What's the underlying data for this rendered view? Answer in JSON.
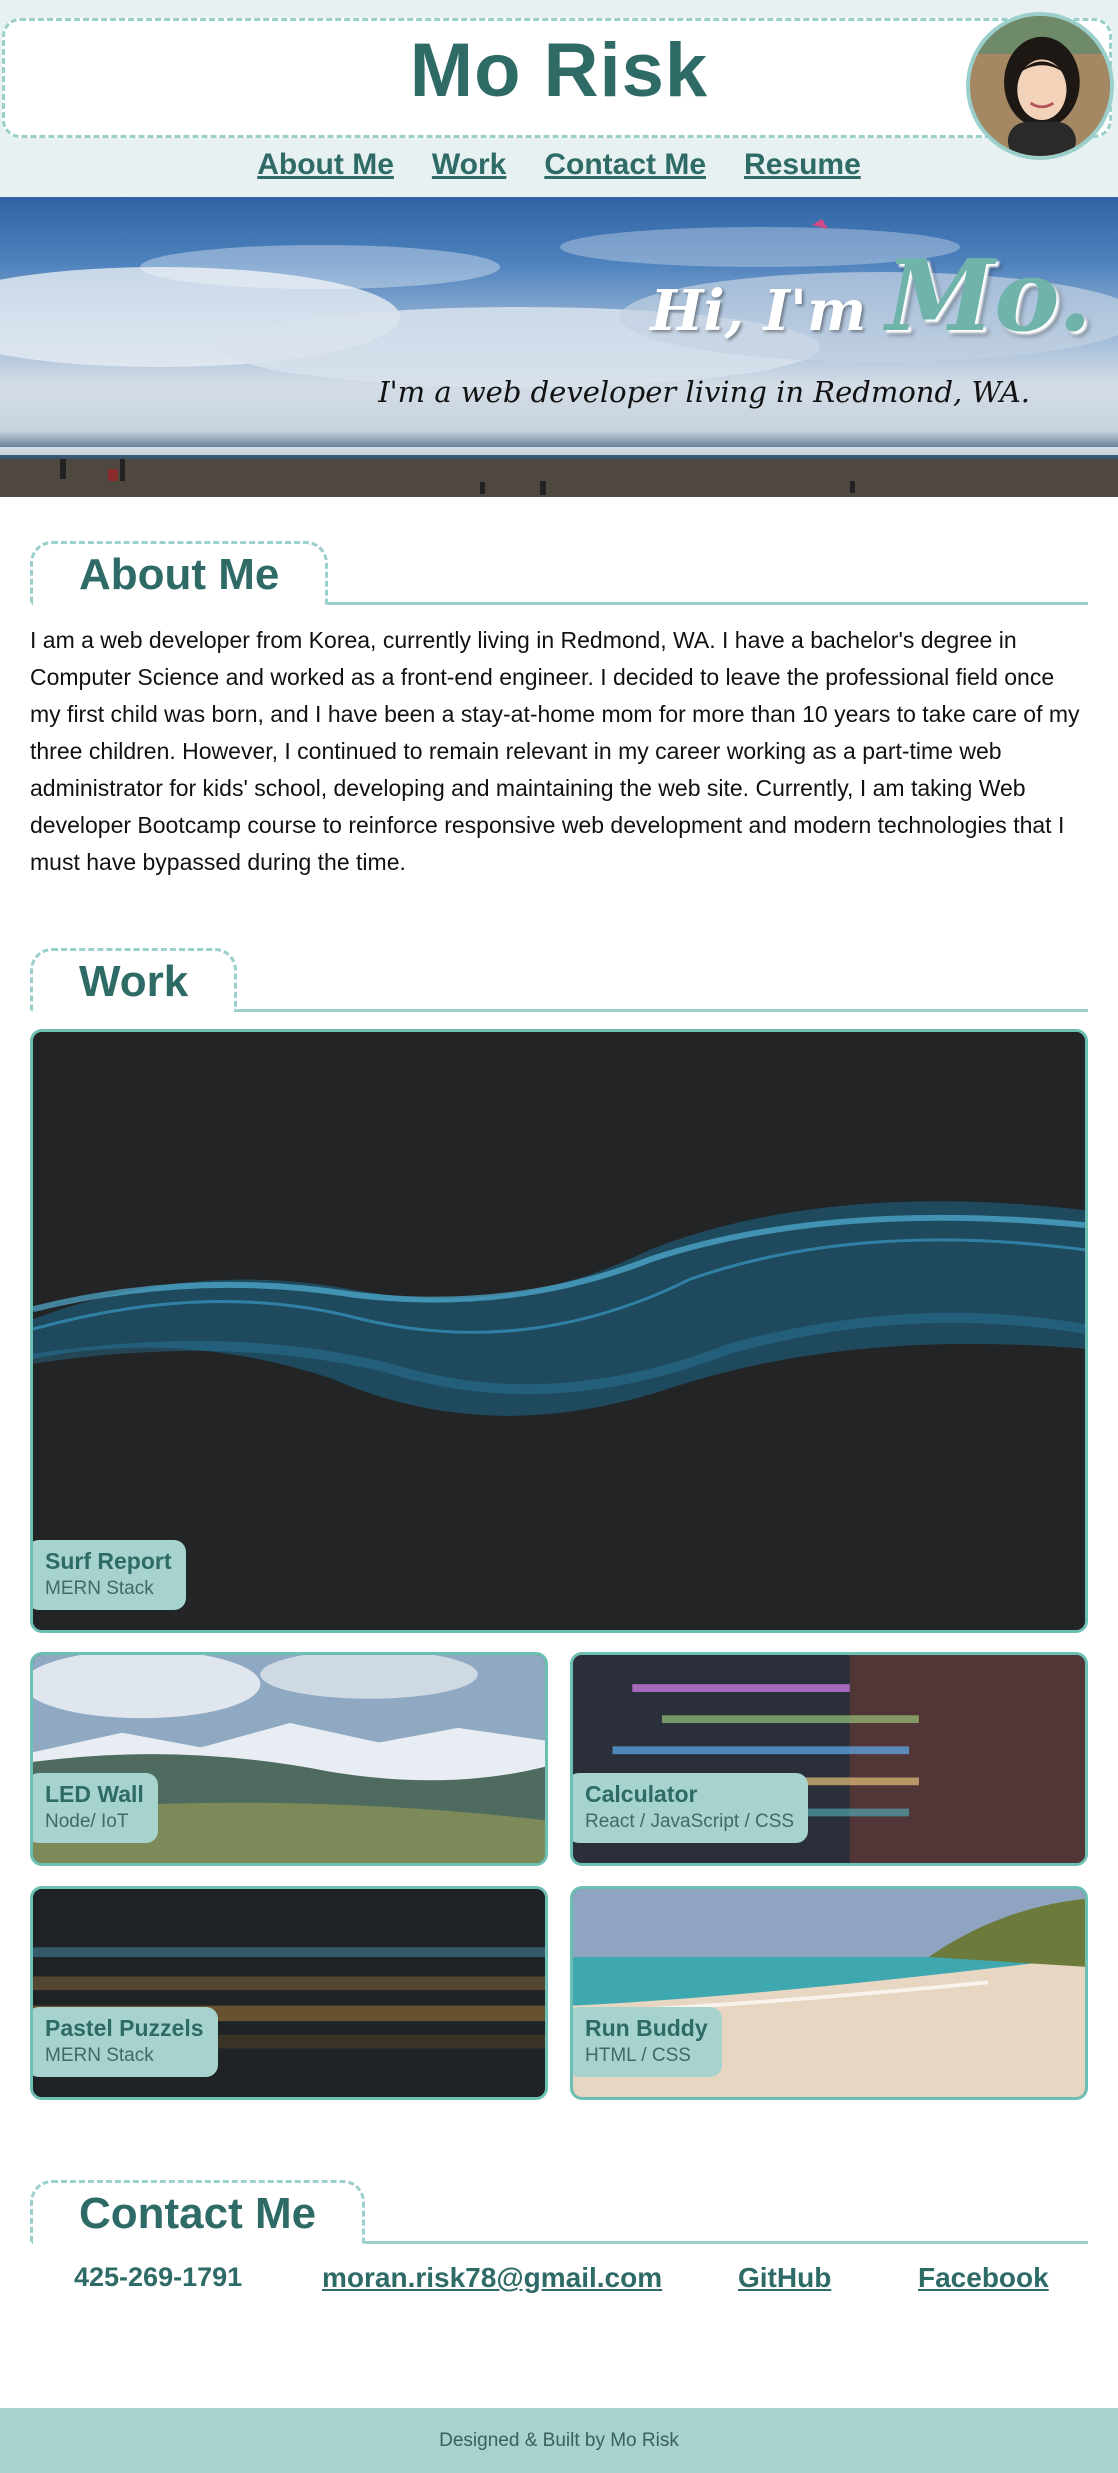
{
  "header": {
    "title": "Mo Risk",
    "avatar_icon": "profile-photo"
  },
  "nav": {
    "items": [
      {
        "label": "About Me"
      },
      {
        "label": "Work"
      },
      {
        "label": "Contact Me"
      },
      {
        "label": "Resume"
      }
    ]
  },
  "hero": {
    "greeting": "Hi, I'm",
    "name": "Mo.",
    "subtitle": "I'm a web developer living in Redmond, WA."
  },
  "about": {
    "heading": "About Me",
    "text": "I am a web developer from Korea, currently living in Redmond, WA. I have a bachelor's degree in Computer Science and worked as a front-end engineer. I decided to leave the professional field once my first child was born, and I have been a stay-at-home mom for more than 10 years to take care of my three children. However, I continued to remain relevant in my career working as a part-time web administrator for kids' school, developing and maintaining the web site. Currently, I am taking Web developer Bootcamp course to reinforce responsive web development and modern technologies that I must have bypassed during the time."
  },
  "work": {
    "heading": "Work",
    "projects": [
      {
        "title": "Surf Report",
        "stack": "MERN Stack"
      },
      {
        "title": "LED Wall",
        "stack": "Node/ IoT"
      },
      {
        "title": "Calculator",
        "stack": "React / JavaScript / CSS"
      },
      {
        "title": "Pastel Puzzels",
        "stack": "MERN Stack"
      },
      {
        "title": "Run Buddy",
        "stack": "HTML / CSS"
      }
    ]
  },
  "contact": {
    "heading": "Contact Me",
    "phone": "425-269-1791",
    "email": "moran.risk78@gmail.com",
    "github": "GitHub",
    "facebook": "Facebook"
  },
  "footer": {
    "text": "Designed & Built by Mo Risk"
  },
  "colors": {
    "accent": "#2e6b67",
    "border": "#9bcfcb",
    "label_bg": "#a7d3cf",
    "header_bg": "#e8f1f1"
  }
}
